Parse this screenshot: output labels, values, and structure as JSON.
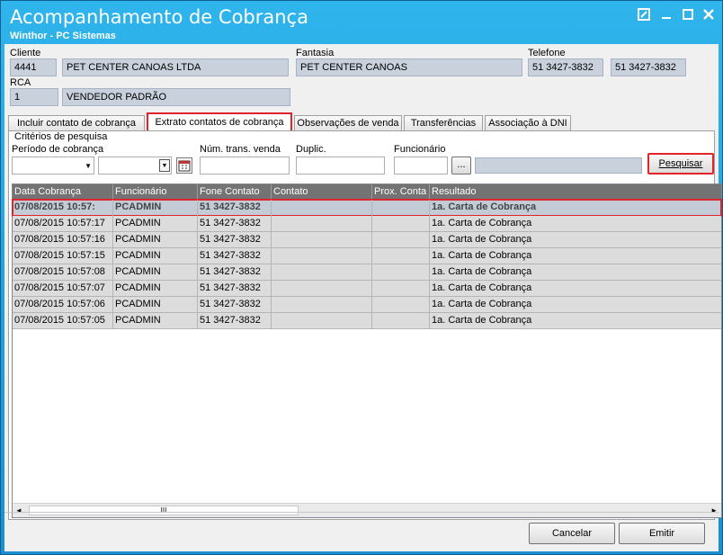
{
  "window": {
    "title": "Acompanhamento de Cobrança",
    "subtitle": "Winthor - PC Sistemas",
    "icons": [
      "edit-icon",
      "minimize-icon",
      "maximize-icon",
      "close-icon"
    ]
  },
  "header": {
    "cliente_label": "Cliente",
    "cliente_code": "4441",
    "cliente_name": "PET CENTER CANOAS LTDA",
    "fantasia_label": "Fantasia",
    "fantasia_value": "PET CENTER CANOAS",
    "telefone_label": "Telefone",
    "telefone1": "51 3427-3832",
    "telefone2": "51 3427-3832",
    "rca_label": "RCA",
    "rca_code": "1",
    "rca_name": "VENDEDOR PADRÃO"
  },
  "tabs": [
    {
      "label": "Incluir contato de cobrança"
    },
    {
      "label": "Extrato contatos de cobrança"
    },
    {
      "label": "Observações de venda"
    },
    {
      "label": "Transferências"
    },
    {
      "label": "Associação à DNI"
    }
  ],
  "criteria": {
    "group_label": "Critérios de pesquisa",
    "periodo_label": "Período de cobrança",
    "num_trans_label": "Núm. trans. venda",
    "duplic_label": "Duplic.",
    "funcionario_label": "Funcionário",
    "ellipsis_label": "...",
    "search_label": "Pesquisar"
  },
  "grid": {
    "columns": [
      "Data Cobrança",
      "Funcionário",
      "Fone Contato",
      "Contato",
      "Prox. Conta",
      "Resultado"
    ],
    "rows": [
      [
        "07/08/2015 10:57:",
        "PCADMIN",
        "51 3427-3832",
        "",
        "",
        "1a. Carta de Cobrança"
      ],
      [
        "07/08/2015 10:57:17",
        "PCADMIN",
        "51 3427-3832",
        "",
        "",
        "1a. Carta de Cobrança"
      ],
      [
        "07/08/2015 10:57:16",
        "PCADMIN",
        "51 3427-3832",
        "",
        "",
        "1a. Carta de Cobrança"
      ],
      [
        "07/08/2015 10:57:15",
        "PCADMIN",
        "51 3427-3832",
        "",
        "",
        "1a. Carta de Cobrança"
      ],
      [
        "07/08/2015 10:57:08",
        "PCADMIN",
        "51 3427-3832",
        "",
        "",
        "1a. Carta de Cobrança"
      ],
      [
        "07/08/2015 10:57:07",
        "PCADMIN",
        "51 3427-3832",
        "",
        "",
        "1a. Carta de Cobrança"
      ],
      [
        "07/08/2015 10:57:06",
        "PCADMIN",
        "51 3427-3832",
        "",
        "",
        "1a. Carta de Cobrança"
      ],
      [
        "07/08/2015 10:57:05",
        "PCADMIN",
        "51 3427-3832",
        "",
        "",
        "1a. Carta de Cobrança"
      ]
    ],
    "scroll_grip": "III"
  },
  "footer": {
    "cancel_label": "Cancelar",
    "emit_label": "Emitir"
  },
  "colors": {
    "title_bar": "#1b8fd0",
    "highlight": "#e0242a",
    "grid_header": "#737373",
    "readonly_field": "#c9d1dd"
  }
}
